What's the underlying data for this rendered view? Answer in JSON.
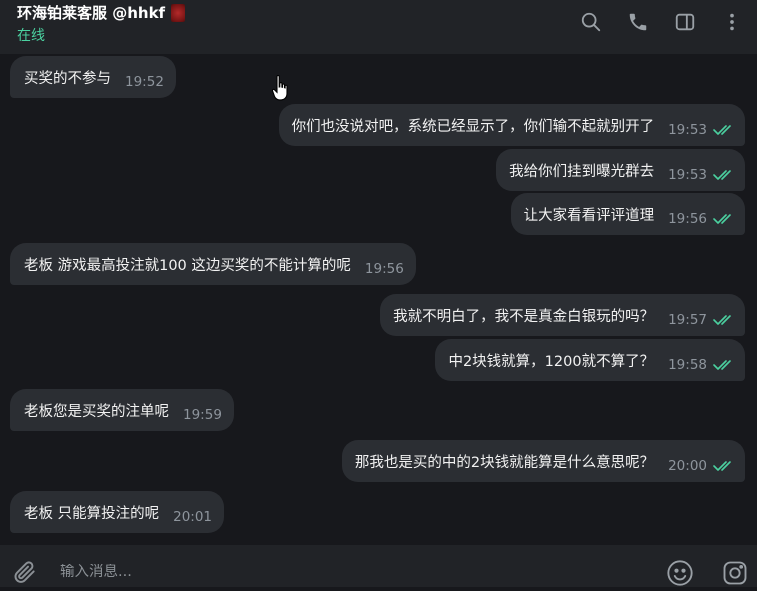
{
  "header": {
    "title": "环海铂莱客服 @hhkf",
    "status": "在线",
    "status_color": "#4bd1a0",
    "icons": [
      "search-icon",
      "phone-icon",
      "sidebar-toggle-icon",
      "more-vertical-icon"
    ]
  },
  "messages": [
    {
      "dir": "in",
      "text": "买奖的不参与",
      "time": "19:52"
    },
    {
      "dir": "out",
      "text": "你们也没说对吧，系统已经显示了，你们输不起就别开了",
      "time": "19:53",
      "read": true
    },
    {
      "dir": "out",
      "text": "我给你们挂到曝光群去",
      "time": "19:53",
      "read": true
    },
    {
      "dir": "out",
      "text": "让大家看看评评道理",
      "time": "19:56",
      "read": true
    },
    {
      "dir": "in",
      "text": "老板 游戏最高投注就100  这边买奖的不能计算的呢",
      "time": "19:56"
    },
    {
      "dir": "out",
      "text": "我就不明白了，我不是真金白银玩的吗？",
      "time": "19:57",
      "read": true
    },
    {
      "dir": "out",
      "text": "中2块钱就算，1200就不算了？",
      "time": "19:58",
      "read": true
    },
    {
      "dir": "in",
      "text": "老板您是买奖的注单呢",
      "time": "19:59"
    },
    {
      "dir": "out",
      "text": "那我也是买的中的2块钱就能算是什么意思呢？",
      "time": "20:00",
      "read": true
    },
    {
      "dir": "in",
      "text": "老板 只能算投注的呢",
      "time": "20:01"
    }
  ],
  "input": {
    "placeholder": "输入消息..."
  },
  "colors": {
    "background": "#17181c",
    "bubble": "#2b2e33",
    "read_tick": "#4bd1a0",
    "bar": "#212327"
  }
}
